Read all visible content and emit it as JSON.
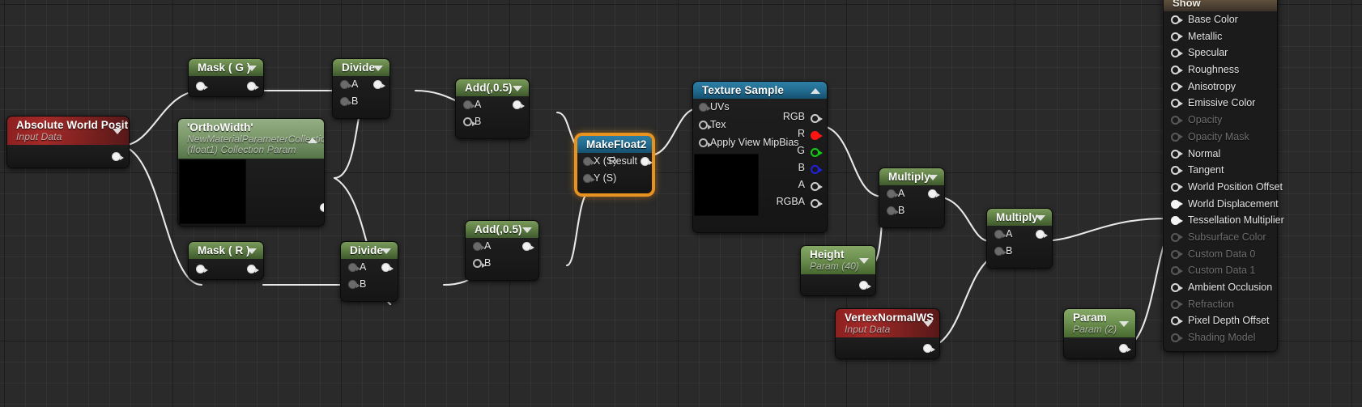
{
  "app": {
    "view": "material-graph-editor",
    "background_color": "#2a2a2a"
  },
  "nodes": {
    "absolute_world_position": {
      "title": "Absolute World Position",
      "subtitle": "Input Data",
      "caret": "chevron-down-icon"
    },
    "ortho_width": {
      "title": "'OrthoWidth'",
      "subtitle_line1": "NewMaterialParameterCollection",
      "subtitle_line2": "(float1) Collection Param",
      "caret": "chevron-up-icon"
    },
    "mask_g": {
      "title": "Mask ( G )",
      "caret": "chevron-down-icon"
    },
    "mask_r": {
      "title": "Mask ( R )",
      "caret": "chevron-down-icon"
    },
    "divide_top": {
      "title": "Divide",
      "caret": "chevron-down-icon",
      "inputs": [
        "A",
        "B"
      ]
    },
    "divide_bottom": {
      "title": "Divide",
      "caret": "chevron-down-icon",
      "inputs": [
        "A",
        "B"
      ]
    },
    "add_top": {
      "title": "Add(,0.5)",
      "caret": "chevron-down-icon",
      "inputs": [
        "A",
        "B"
      ]
    },
    "add_bottom": {
      "title": "Add(,0.5)",
      "caret": "chevron-down-icon",
      "inputs": [
        "A",
        "B"
      ]
    },
    "make_float2": {
      "title": "MakeFloat2",
      "selected": true,
      "inputs": [
        "X (S)",
        "Y (S)"
      ],
      "output": "Result"
    },
    "texture_sample": {
      "title": "Texture Sample",
      "caret": "chevron-up-icon",
      "inputs": [
        "UVs",
        "Tex",
        "Apply View MipBias"
      ],
      "outputs": [
        {
          "label": "RGB",
          "color": "#cfcfcf",
          "connected": false
        },
        {
          "label": "R",
          "color": "#ff1414",
          "connected": true
        },
        {
          "label": "G",
          "color": "#14cc14",
          "connected": false
        },
        {
          "label": "B",
          "color": "#2020e0",
          "connected": false
        },
        {
          "label": "A",
          "color": "#cfcfcf",
          "connected": false
        },
        {
          "label": "RGBA",
          "color": "#cfcfcf",
          "connected": false
        }
      ]
    },
    "multiply_1": {
      "title": "Multiply",
      "caret": "chevron-down-icon",
      "inputs": [
        "A",
        "B"
      ]
    },
    "multiply_2": {
      "title": "Multiply",
      "caret": "chevron-down-icon",
      "inputs": [
        "A",
        "B"
      ]
    },
    "height": {
      "title": "Height",
      "subtitle": "Param (40)",
      "caret": "chevron-down-icon"
    },
    "vertex_normal_ws": {
      "title": "VertexNormalWS",
      "subtitle": "Input Data",
      "caret": "chevron-down-icon"
    },
    "param_2": {
      "title": "Param",
      "subtitle": "Param (2)",
      "caret": "chevron-down-icon"
    }
  },
  "show_panel": {
    "header": "Show",
    "outputs": [
      {
        "label": "Base Color",
        "enabled": true,
        "connected": false
      },
      {
        "label": "Metallic",
        "enabled": true,
        "connected": false
      },
      {
        "label": "Specular",
        "enabled": true,
        "connected": false
      },
      {
        "label": "Roughness",
        "enabled": true,
        "connected": false
      },
      {
        "label": "Anisotropy",
        "enabled": true,
        "connected": false
      },
      {
        "label": "Emissive Color",
        "enabled": true,
        "connected": false
      },
      {
        "label": "Opacity",
        "enabled": false,
        "connected": false
      },
      {
        "label": "Opacity Mask",
        "enabled": false,
        "connected": false
      },
      {
        "label": "Normal",
        "enabled": true,
        "connected": false
      },
      {
        "label": "Tangent",
        "enabled": true,
        "connected": false
      },
      {
        "label": "World Position Offset",
        "enabled": true,
        "connected": false
      },
      {
        "label": "World Displacement",
        "enabled": true,
        "connected": true
      },
      {
        "label": "Tessellation Multiplier",
        "enabled": true,
        "connected": true
      },
      {
        "label": "Subsurface Color",
        "enabled": false,
        "connected": false
      },
      {
        "label": "Custom Data 0",
        "enabled": false,
        "connected": false
      },
      {
        "label": "Custom Data 1",
        "enabled": false,
        "connected": false
      },
      {
        "label": "Ambient Occlusion",
        "enabled": true,
        "connected": false
      },
      {
        "label": "Refraction",
        "enabled": false,
        "connected": false
      },
      {
        "label": "Pixel Depth Offset",
        "enabled": true,
        "connected": false
      },
      {
        "label": "Shading Model",
        "enabled": false,
        "connected": false
      }
    ]
  },
  "colors": {
    "wire": "#e8e8e8",
    "selection": "#e8921f",
    "node_green": "#6d9150",
    "node_red": "#a32a28",
    "node_blue": "#236c91",
    "panel_header": "#534636"
  }
}
